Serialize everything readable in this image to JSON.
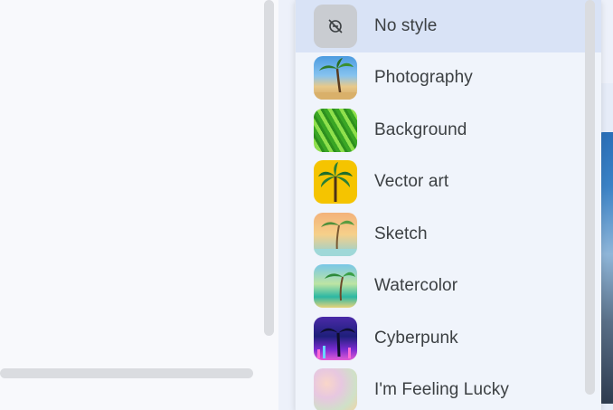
{
  "menu": {
    "items": [
      {
        "label": "No style",
        "icon": "no-style-icon",
        "selected": true
      },
      {
        "label": "Photography",
        "icon": "photography-thumbnail",
        "selected": false
      },
      {
        "label": "Background",
        "icon": "background-thumbnail",
        "selected": false
      },
      {
        "label": "Vector art",
        "icon": "vector-art-thumbnail",
        "selected": false
      },
      {
        "label": "Sketch",
        "icon": "sketch-thumbnail",
        "selected": false
      },
      {
        "label": "Watercolor",
        "icon": "watercolor-thumbnail",
        "selected": false
      },
      {
        "label": "Cyberpunk",
        "icon": "cyberpunk-thumbnail",
        "selected": false
      },
      {
        "label": "I'm Feeling Lucky",
        "icon": "feeling-lucky-thumbnail",
        "selected": false
      }
    ]
  },
  "colors": {
    "selected_row": "#d9e3f6",
    "menu_bg": "#f0f4fb",
    "text": "#3c4043"
  }
}
